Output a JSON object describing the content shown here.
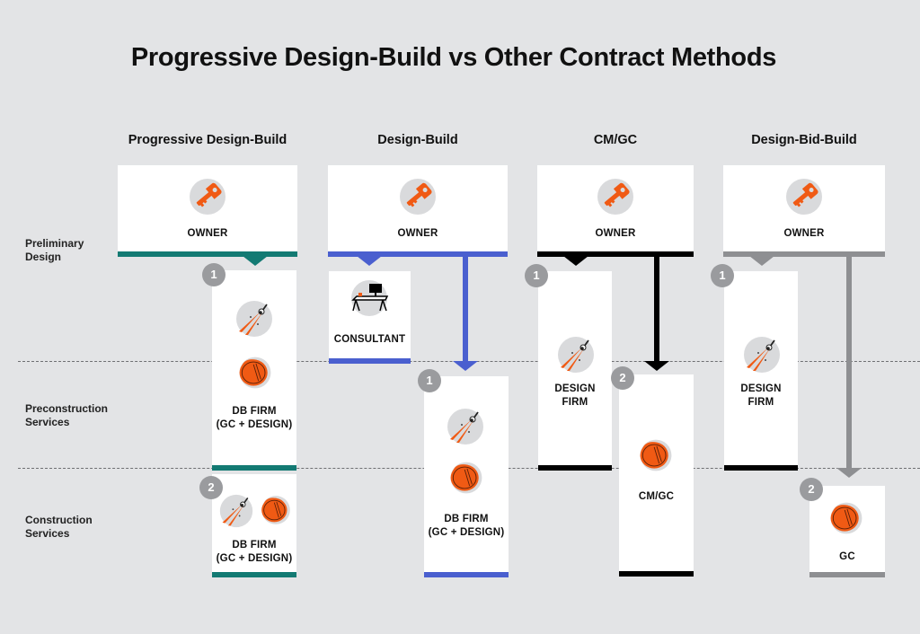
{
  "title": "Progressive Design-Build vs Other Contract Methods",
  "phases": [
    "Preliminary Design",
    "Preconstruction Services",
    "Construction Services"
  ],
  "phase_lines": [
    [
      "Preliminary",
      "Design"
    ],
    [
      "Preconstruction",
      "Services"
    ],
    [
      "Construction",
      "Services"
    ]
  ],
  "colors": {
    "background": "#e3e4e6",
    "progressive_design_build": "#137a73",
    "design_build": "#4a5fcf",
    "cm_gc": "#000000",
    "design_bid_build": "#8e8f92",
    "icon_orange": "#f05a14",
    "badge": "#9a9b9e"
  },
  "methods": [
    {
      "name": "Progressive Design-Build",
      "owner": "OWNER",
      "entities": [
        {
          "badge": "1",
          "label": [
            "DB FIRM",
            "(GC + DESIGN)"
          ],
          "icons": [
            "compass-icon",
            "hard-hat-icon"
          ],
          "phase": "Preliminary Design / Preconstruction Services"
        },
        {
          "badge": "2",
          "label": [
            "DB FIRM",
            "(GC + DESIGN)"
          ],
          "icons": [
            "compass-icon",
            "hard-hat-icon"
          ],
          "phase": "Construction Services"
        }
      ]
    },
    {
      "name": "Design-Build",
      "owner": "OWNER",
      "entities": [
        {
          "badge": "",
          "label": [
            "CONSULTANT"
          ],
          "icons": [
            "desk-icon"
          ],
          "phase": "Preliminary Design"
        },
        {
          "badge": "1",
          "label": [
            "DB FIRM",
            "(GC + DESIGN)"
          ],
          "icons": [
            "compass-icon",
            "hard-hat-icon"
          ],
          "phase": "Preconstruction / Construction Services"
        }
      ]
    },
    {
      "name": "CM/GC",
      "owner": "OWNER",
      "entities": [
        {
          "badge": "1",
          "label": [
            "DESIGN",
            "FIRM"
          ],
          "icons": [
            "compass-icon"
          ],
          "phase": "Preliminary Design / Preconstruction Services"
        },
        {
          "badge": "2",
          "label": [
            "CM/GC"
          ],
          "icons": [
            "hard-hat-icon"
          ],
          "phase": "Preconstruction / Construction Services"
        }
      ]
    },
    {
      "name": "Design-Bid-Build",
      "owner": "OWNER",
      "entities": [
        {
          "badge": "1",
          "label": [
            "DESIGN",
            "FIRM"
          ],
          "icons": [
            "compass-icon"
          ],
          "phase": "Preliminary Design / Preconstruction Services"
        },
        {
          "badge": "2",
          "label": [
            "GC"
          ],
          "icons": [
            "hard-hat-icon"
          ],
          "phase": "Construction Services"
        }
      ]
    }
  ]
}
